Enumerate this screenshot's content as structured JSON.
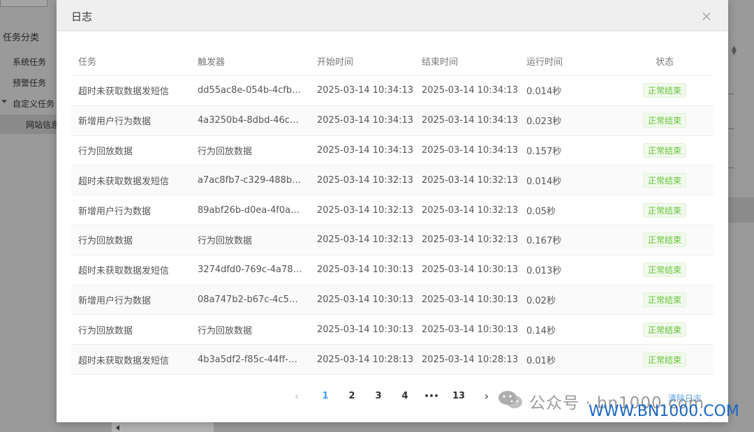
{
  "background": {
    "tree_title": "任务分类",
    "tree_items": [
      "系统任务",
      "预警任务",
      "自定义任务",
      "网站信息"
    ]
  },
  "modal": {
    "title": "日志",
    "close_icon": "close-icon"
  },
  "table": {
    "headers": {
      "task": "任务",
      "trigger": "触发器",
      "start": "开始时间",
      "end": "结束时间",
      "duration": "运行时间",
      "status": "状态"
    },
    "rows": [
      {
        "task": "超时未获取数据发短信",
        "trigger": "dd55ac8e-054b-4cfb-b...",
        "start": "2025-03-14 10:34:13",
        "end": "2025-03-14 10:34:13",
        "duration": "0.014秒",
        "status": "正常结束"
      },
      {
        "task": "新增用户行为数据",
        "trigger": "4a3250b4-8dbd-46c1-9...",
        "start": "2025-03-14 10:34:13",
        "end": "2025-03-14 10:34:13",
        "duration": "0.023秒",
        "status": "正常结束"
      },
      {
        "task": "行为回放数据",
        "trigger": "行为回放数据",
        "start": "2025-03-14 10:34:13",
        "end": "2025-03-14 10:34:13",
        "duration": "0.157秒",
        "status": "正常结束"
      },
      {
        "task": "超时未获取数据发短信",
        "trigger": "a7ac8fb7-c329-488b-9...",
        "start": "2025-03-14 10:32:13",
        "end": "2025-03-14 10:32:13",
        "duration": "0.014秒",
        "status": "正常结束"
      },
      {
        "task": "新增用户行为数据",
        "trigger": "89abf26b-d0ea-4f0a-a7...",
        "start": "2025-03-14 10:32:13",
        "end": "2025-03-14 10:32:13",
        "duration": "0.05秒",
        "status": "正常结束"
      },
      {
        "task": "行为回放数据",
        "trigger": "行为回放数据",
        "start": "2025-03-14 10:32:13",
        "end": "2025-03-14 10:32:13",
        "duration": "0.167秒",
        "status": "正常结束"
      },
      {
        "task": "超时未获取数据发短信",
        "trigger": "3274dfd0-769c-4a78-9...",
        "start": "2025-03-14 10:30:13",
        "end": "2025-03-14 10:30:13",
        "duration": "0.013秒",
        "status": "正常结束"
      },
      {
        "task": "新增用户行为数据",
        "trigger": "08a747b2-b67c-4c59-8...",
        "start": "2025-03-14 10:30:13",
        "end": "2025-03-14 10:30:13",
        "duration": "0.02秒",
        "status": "正常结束"
      },
      {
        "task": "行为回放数据",
        "trigger": "行为回放数据",
        "start": "2025-03-14 10:30:13",
        "end": "2025-03-14 10:30:13",
        "duration": "0.14秒",
        "status": "正常结束"
      },
      {
        "task": "超时未获取数据发短信",
        "trigger": "4b3a5df2-f85c-44ff-80c...",
        "start": "2025-03-14 10:28:13",
        "end": "2025-03-14 10:28:13",
        "duration": "0.01秒",
        "status": "正常结束"
      }
    ]
  },
  "pagination": {
    "prev_icon": "chevron-left-icon",
    "next_icon": "chevron-right-icon",
    "pages": [
      "1",
      "2",
      "3",
      "4",
      "•••",
      "13"
    ],
    "active_page": "1",
    "extra_link": "清除日志"
  },
  "watermark": {
    "text": "公众号 · bn1000.com",
    "url": "WWW.BN1000.COM"
  },
  "colors": {
    "active_page": "#409eff",
    "status_tag_text": "#67c23a",
    "status_tag_bg": "#f0f9eb",
    "overlay": "#8f8f8f",
    "watermark_url": "#1a66c6"
  }
}
